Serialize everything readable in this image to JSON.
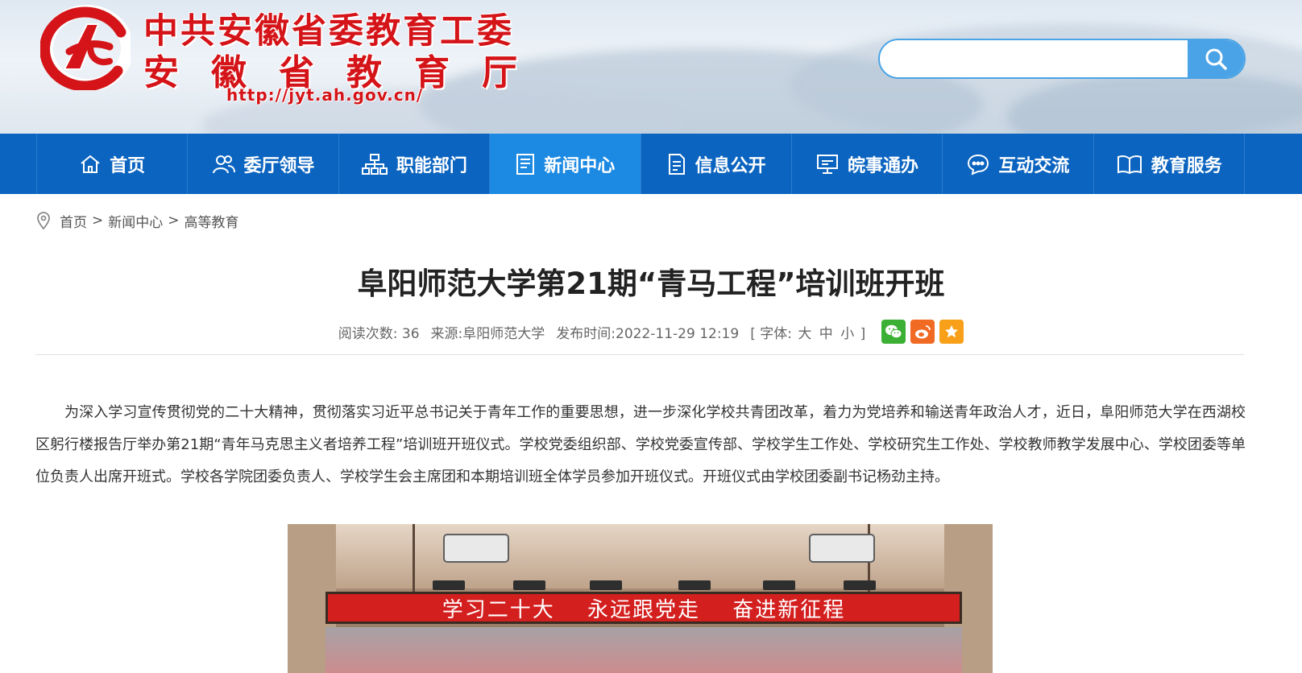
{
  "header": {
    "org_name_line1": "中共安徽省委教育工委",
    "org_name_line2": "安徽省教育厅",
    "site_url": "http://jyt.ah.gov.cn/",
    "search": {
      "placeholder": "",
      "value": ""
    }
  },
  "nav": {
    "items": [
      {
        "label": "首页",
        "icon": "home-icon"
      },
      {
        "label": "委厅领导",
        "icon": "users-icon"
      },
      {
        "label": "职能部门",
        "icon": "org-chart-icon"
      },
      {
        "label": "新闻中心",
        "icon": "news-icon",
        "active": true
      },
      {
        "label": "信息公开",
        "icon": "document-icon"
      },
      {
        "label": "皖事通办",
        "icon": "monitor-icon"
      },
      {
        "label": "互动交流",
        "icon": "chat-icon"
      },
      {
        "label": "教育服务",
        "icon": "book-icon"
      }
    ]
  },
  "breadcrumb": {
    "items": [
      "首页",
      "新闻中心",
      "高等教育"
    ],
    "separator": ">"
  },
  "article": {
    "title": "阜阳师范大学第21期“青马工程”培训班开班",
    "meta": {
      "views_label": "阅读次数:",
      "views": "36",
      "source_label": "来源:",
      "source": "阜阳师范大学",
      "published_label": "发布时间:",
      "published": "2022-11-29 12:19",
      "font_label": "[ 字体:",
      "font_large": "大",
      "font_medium": "中",
      "font_small": "小",
      "font_close": "]"
    },
    "paragraph": "为深入学习宣传贯彻党的二十大精神，贯彻落实习近平总书记关于青年工作的重要思想，进一步深化学校共青团改革，着力为党培养和输送青年政治人才，近日，阜阳师范大学在西湖校区躬行楼报告厅举办第21期“青年马克思主义者培养工程”培训班开班仪式。学校党委组织部、学校党委宣传部、学校学生工作处、学校研究生工作处、学校教师教学发展中心、学校团委等单位负责人出席开班式。学校各学院团委负责人、学校学生会主席团和本期培训班全体学员参加开班仪式。开班仪式由学校团委副书记杨劲主持。",
    "photo_banner": "学习二十大 永远跟党走 奋进新征程"
  },
  "colors": {
    "brand_red": "#d41418",
    "nav_blue": "#0b64c0",
    "nav_active": "#1c8ae3",
    "search_blue": "#4aa3e6"
  }
}
